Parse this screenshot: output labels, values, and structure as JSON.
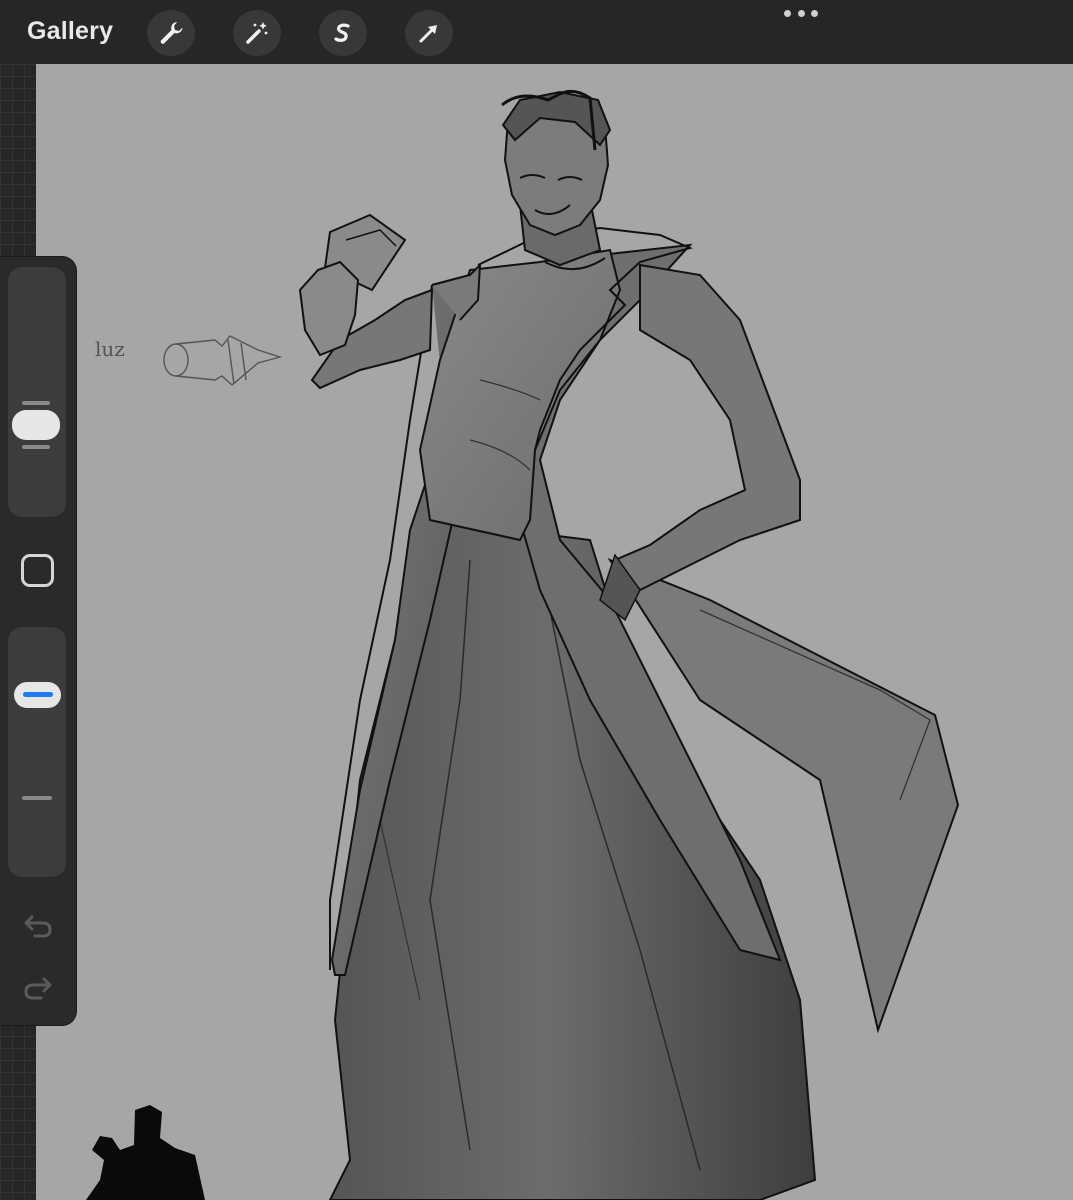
{
  "toolbar": {
    "gallery_label": "Gallery",
    "tools": [
      {
        "icon": "wrench-icon",
        "name": "actions"
      },
      {
        "icon": "magic-wand-icon",
        "name": "adjustments"
      },
      {
        "icon": "selection-s-icon",
        "name": "selection"
      },
      {
        "icon": "arrow-cursor-icon",
        "name": "transform"
      }
    ],
    "more_icon": "ellipsis-icon"
  },
  "canvas": {
    "background_color": "#a6a6a6",
    "sketch_label": "luz"
  },
  "sidebar": {
    "brush_size_level": 0.37,
    "opacity_level": 0.25,
    "modify_icon": "square-icon",
    "undo_icon": "undo-icon",
    "redo_icon": "redo-icon",
    "accent_color": "#1e7cf0"
  }
}
